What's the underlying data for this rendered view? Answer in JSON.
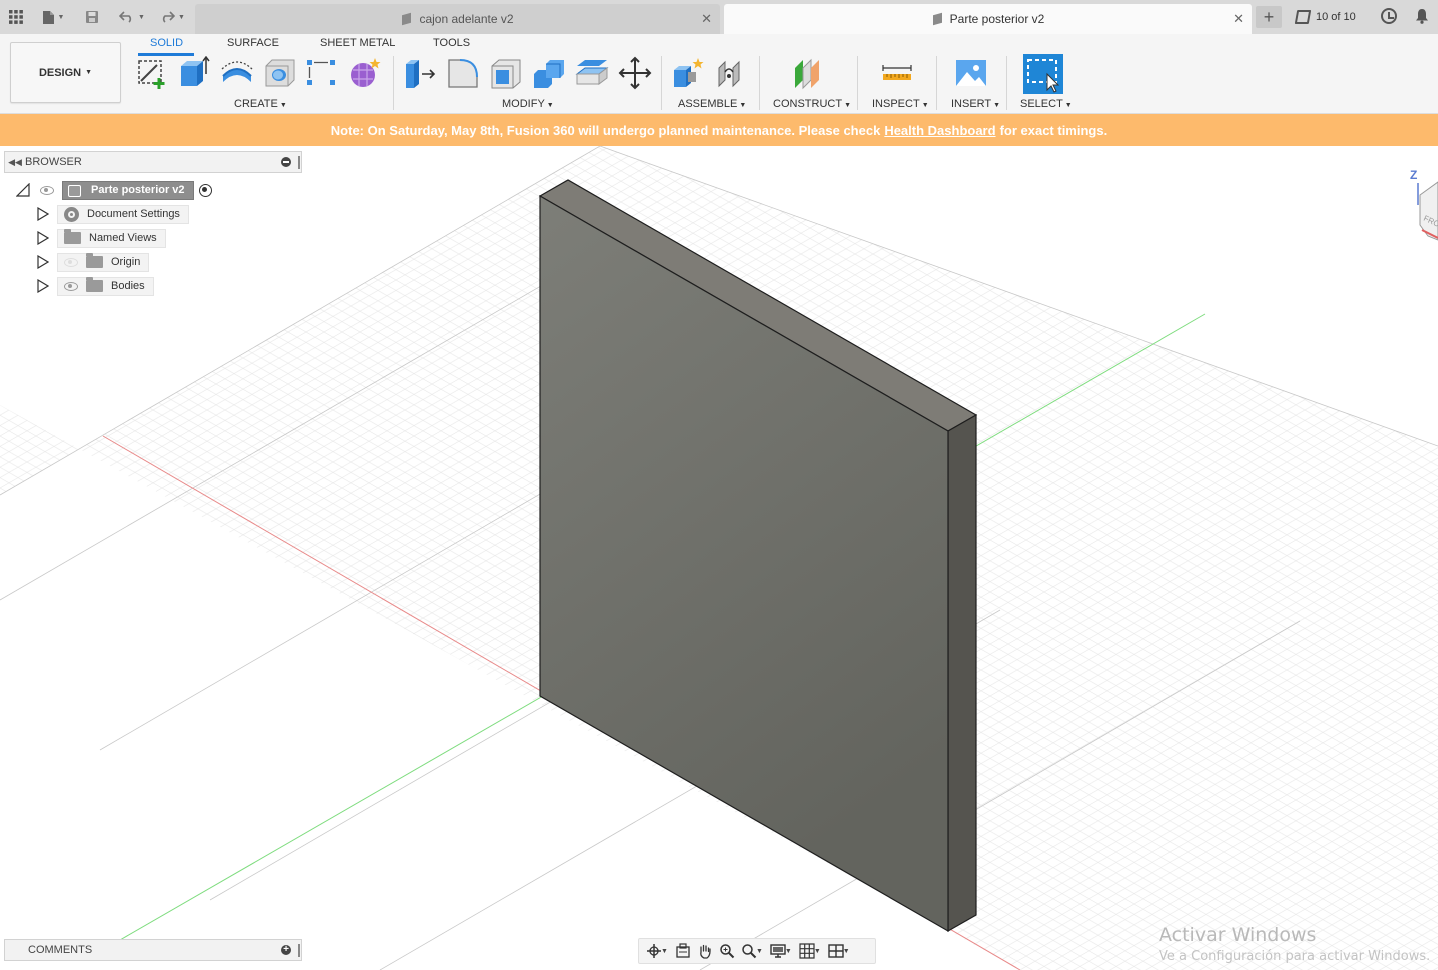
{
  "tabs": {
    "inactive": {
      "label": "cajon adelante v2"
    },
    "active": {
      "label": "Parte posterior v2"
    }
  },
  "version": {
    "label": "10 of 10"
  },
  "toolbar": {
    "workspace": "DESIGN",
    "workspace_tabs": [
      "SOLID",
      "SURFACE",
      "SHEET METAL",
      "TOOLS"
    ],
    "groups": {
      "create": "CREATE",
      "modify": "MODIFY",
      "assemble": "ASSEMBLE",
      "construct": "CONSTRUCT",
      "inspect": "INSPECT",
      "insert": "INSERT",
      "select": "SELECT"
    }
  },
  "notice": {
    "before": "Note: On Saturday, May 8th, Fusion 360 will undergo planned maintenance. Please check",
    "link": "Health Dashboard",
    "after": "for exact timings.",
    "bg_color": "#fdba6c"
  },
  "browser": {
    "title": "BROWSER",
    "root": "Parte posterior v2",
    "items": [
      {
        "label": "Document Settings",
        "icon": "gear-icon"
      },
      {
        "label": "Named Views",
        "icon": "folder-icon"
      },
      {
        "label": "Origin",
        "icon": "folder-icon",
        "visible": false
      },
      {
        "label": "Bodies",
        "icon": "folder-icon",
        "visible": true
      }
    ]
  },
  "comments": {
    "title": "COMMENTS"
  },
  "viewcube": {
    "axis": "Z",
    "face": "FRO"
  },
  "watermark": {
    "title": "Activar Windows",
    "subtitle": "Ve a Configuración para activar Windows."
  },
  "colors": {
    "accent": "#1f7bd8",
    "x_axis": "#e06060",
    "y_axis": "#6ed36e",
    "body_face": "#6f706a"
  }
}
